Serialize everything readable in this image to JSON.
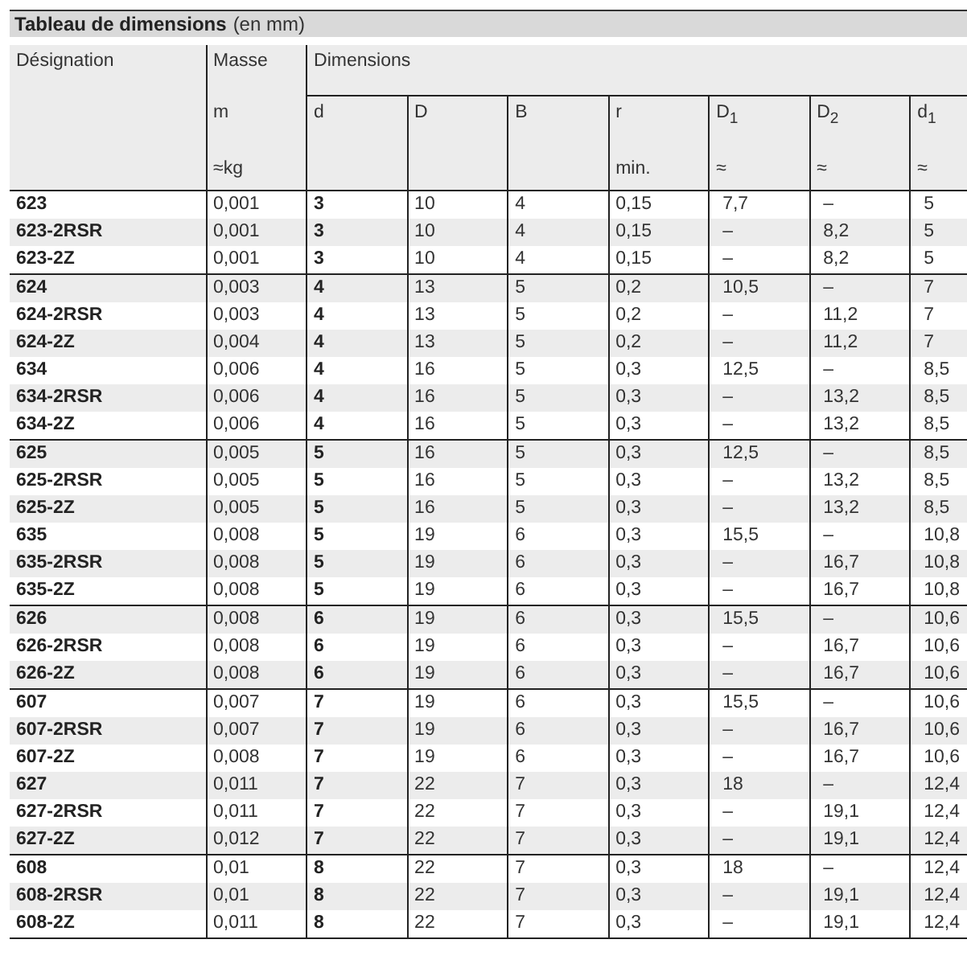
{
  "title": "Tableau de dimensions",
  "title_note": "(en mm)",
  "header": {
    "designation": "Désignation",
    "mass": {
      "label": "Masse",
      "symbol": "m",
      "unit": "≈kg"
    },
    "dimensions": "Dimensions",
    "columns": [
      {
        "symbol": "d"
      },
      {
        "symbol": "D"
      },
      {
        "symbol": "B"
      },
      {
        "symbol": "r",
        "note": "min."
      },
      {
        "symbol": "D$_{1}$",
        "note": "≈"
      },
      {
        "symbol": "D$_{2}$",
        "note": "≈"
      },
      {
        "symbol": "d$_{1}$",
        "note": "≈"
      }
    ]
  },
  "groups": [
    [
      [
        "623",
        "0,001",
        "3",
        "10",
        "4",
        "0,15",
        "7,7",
        "–",
        "5"
      ],
      [
        "623-2RSR",
        "0,001",
        "3",
        "10",
        "4",
        "0,15",
        "–",
        "8,2",
        "5"
      ],
      [
        "623-2Z",
        "0,001",
        "3",
        "10",
        "4",
        "0,15",
        "–",
        "8,2",
        "5"
      ]
    ],
    [
      [
        "624",
        "0,003",
        "4",
        "13",
        "5",
        "0,2",
        "10,5",
        "–",
        "7"
      ],
      [
        "624-2RSR",
        "0,003",
        "4",
        "13",
        "5",
        "0,2",
        "–",
        "11,2",
        "7"
      ],
      [
        "624-2Z",
        "0,004",
        "4",
        "13",
        "5",
        "0,2",
        "–",
        "11,2",
        "7"
      ],
      [
        "634",
        "0,006",
        "4",
        "16",
        "5",
        "0,3",
        "12,5",
        "–",
        "8,5"
      ],
      [
        "634-2RSR",
        "0,006",
        "4",
        "16",
        "5",
        "0,3",
        "–",
        "13,2",
        "8,5"
      ],
      [
        "634-2Z",
        "0,006",
        "4",
        "16",
        "5",
        "0,3",
        "–",
        "13,2",
        "8,5"
      ]
    ],
    [
      [
        "625",
        "0,005",
        "5",
        "16",
        "5",
        "0,3",
        "12,5",
        "–",
        "8,5"
      ],
      [
        "625-2RSR",
        "0,005",
        "5",
        "16",
        "5",
        "0,3",
        "–",
        "13,2",
        "8,5"
      ],
      [
        "625-2Z",
        "0,005",
        "5",
        "16",
        "5",
        "0,3",
        "–",
        "13,2",
        "8,5"
      ],
      [
        "635",
        "0,008",
        "5",
        "19",
        "6",
        "0,3",
        "15,5",
        "–",
        "10,8"
      ],
      [
        "635-2RSR",
        "0,008",
        "5",
        "19",
        "6",
        "0,3",
        "–",
        "16,7",
        "10,8"
      ],
      [
        "635-2Z",
        "0,008",
        "5",
        "19",
        "6",
        "0,3",
        "–",
        "16,7",
        "10,8"
      ]
    ],
    [
      [
        "626",
        "0,008",
        "6",
        "19",
        "6",
        "0,3",
        "15,5",
        "–",
        "10,6"
      ],
      [
        "626-2RSR",
        "0,008",
        "6",
        "19",
        "6",
        "0,3",
        "–",
        "16,7",
        "10,6"
      ],
      [
        "626-2Z",
        "0,008",
        "6",
        "19",
        "6",
        "0,3",
        "–",
        "16,7",
        "10,6"
      ]
    ],
    [
      [
        "607",
        "0,007",
        "7",
        "19",
        "6",
        "0,3",
        "15,5",
        "–",
        "10,6"
      ],
      [
        "607-2RSR",
        "0,007",
        "7",
        "19",
        "6",
        "0,3",
        "–",
        "16,7",
        "10,6"
      ],
      [
        "607-2Z",
        "0,008",
        "7",
        "19",
        "6",
        "0,3",
        "–",
        "16,7",
        "10,6"
      ],
      [
        "627",
        "0,011",
        "7",
        "22",
        "7",
        "0,3",
        "18",
        "–",
        "12,4"
      ],
      [
        "627-2RSR",
        "0,011",
        "7",
        "22",
        "7",
        "0,3",
        "–",
        "19,1",
        "12,4"
      ],
      [
        "627-2Z",
        "0,012",
        "7",
        "22",
        "7",
        "0,3",
        "–",
        "19,1",
        "12,4"
      ]
    ],
    [
      [
        "608",
        "0,01",
        "8",
        "22",
        "7",
        "0,3",
        "18",
        "–",
        "12,4"
      ],
      [
        "608-2RSR",
        "0,01",
        "8",
        "22",
        "7",
        "0,3",
        "–",
        "19,1",
        "12,4"
      ],
      [
        "608-2Z",
        "0,011",
        "8",
        "22",
        "7",
        "0,3",
        "–",
        "19,1",
        "12,4"
      ]
    ]
  ]
}
